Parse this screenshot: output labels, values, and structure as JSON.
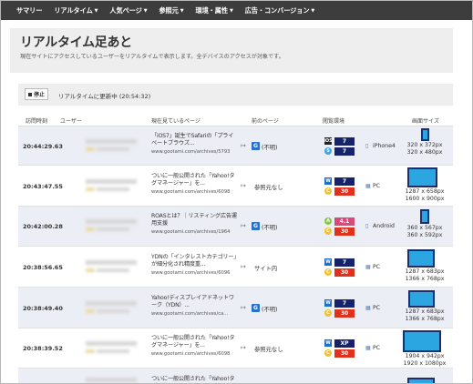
{
  "nav": [
    "サマリー",
    "リアルタイム",
    "人気ページ",
    "参照元",
    "環境・属性",
    "広告・コンバージョン"
  ],
  "header": {
    "title": "リアルタイム足あと",
    "description": "現在サイトにアクセスしているユーザーをリアルタイムで表示します。全デバイスのアクセスが対象です。"
  },
  "status": {
    "stop_label": "停止",
    "text": "リアルタイムに更新中 (20:54:32)"
  },
  "columns": {
    "time": "訪問時刻",
    "user": "ユーザー",
    "page": "現在見ているページ",
    "prev": "前のページ",
    "env": "閲覧環境",
    "screen": "画面サイズ"
  },
  "colors": {
    "nav": "#3d3d3d",
    "alt_row": "#eceef5",
    "screen_fill": "#2ba6e0",
    "screen_border": "#1a2f6b"
  },
  "rows": [
    {
      "time": "20:44:29.63",
      "page_title": "「iOS7」誕生でSafariの「プライベートブラウズ...",
      "url": "www.gootami.com/archives/5793",
      "prev": "(不明)",
      "prev_icon": "G",
      "os_badge": "iOS",
      "browser_badge": "S",
      "os_ver": "7",
      "browser_ver": "7",
      "device": "iPhone4",
      "screen1": "320 x 372px",
      "screen2": "320 x 480px"
    },
    {
      "time": "20:43:47.55",
      "page_title": "ついに一般公開された「Yahoo!タグマネージャー」を...",
      "url": "www.gootami.com/archives/6098",
      "prev": "参照元なし",
      "prev_icon": "",
      "os_badge": "W",
      "browser_badge": "C",
      "os_ver": "7",
      "browser_ver": "30",
      "device": "PC",
      "screen1": "1287 x 658px",
      "screen2": "1600 x 900px"
    },
    {
      "time": "20:42:00.28",
      "page_title": "ROASとは？｜リスティング広告運用支援",
      "url": "www.gootami.com/archives/1964",
      "prev": "(不明)",
      "prev_icon": "G",
      "os_badge": "A",
      "browser_badge": "C",
      "os_ver": "4.1",
      "browser_ver": "30",
      "device": "Android",
      "screen1": "360 x 567px",
      "screen2": "360 x 592px"
    },
    {
      "time": "20:38:56.65",
      "page_title": "YDNの「インタレストカテゴリー」が細分化され精度重...",
      "url": "www.gootami.com/archives/6096",
      "prev": "サイト内",
      "prev_icon": "",
      "os_badge": "W",
      "browser_badge": "C",
      "os_ver": "7",
      "browser_ver": "30",
      "device": "PC",
      "screen1": "1287 x 683px",
      "screen2": "1366 x 768px"
    },
    {
      "time": "20:38:49.40",
      "page_title": "Yahoo!ディスプレイアドネットワーク（YDN）...",
      "url": "www.gootami.com/archives/ca...",
      "prev": "(不明)",
      "prev_icon": "G",
      "os_badge": "W",
      "browser_badge": "C",
      "os_ver": "7",
      "browser_ver": "30",
      "device": "PC",
      "screen1": "1287 x 683px",
      "screen2": "1366 x 768px"
    },
    {
      "time": "20:38:39.52",
      "page_title": "ついに一般公開された「Yahoo!タグマネージャー」を...",
      "url": "www.gootami.com/archives/6098",
      "prev": "参照元なし",
      "prev_icon": "",
      "os_badge": "W",
      "browser_badge": "C",
      "os_ver": "XP",
      "browser_ver": "30",
      "device": "PC",
      "screen1": "1904 x 942px",
      "screen2": "1920 x 1080px"
    },
    {
      "time": "",
      "page_title": "ついに一般公開された「Yahoo!タグマネージャー」を...",
      "url": "",
      "prev": "",
      "prev_icon": "",
      "os_badge": "",
      "browser_badge": "",
      "os_ver": "",
      "browser_ver": "",
      "device": "",
      "screen1": "",
      "screen2": ""
    }
  ]
}
